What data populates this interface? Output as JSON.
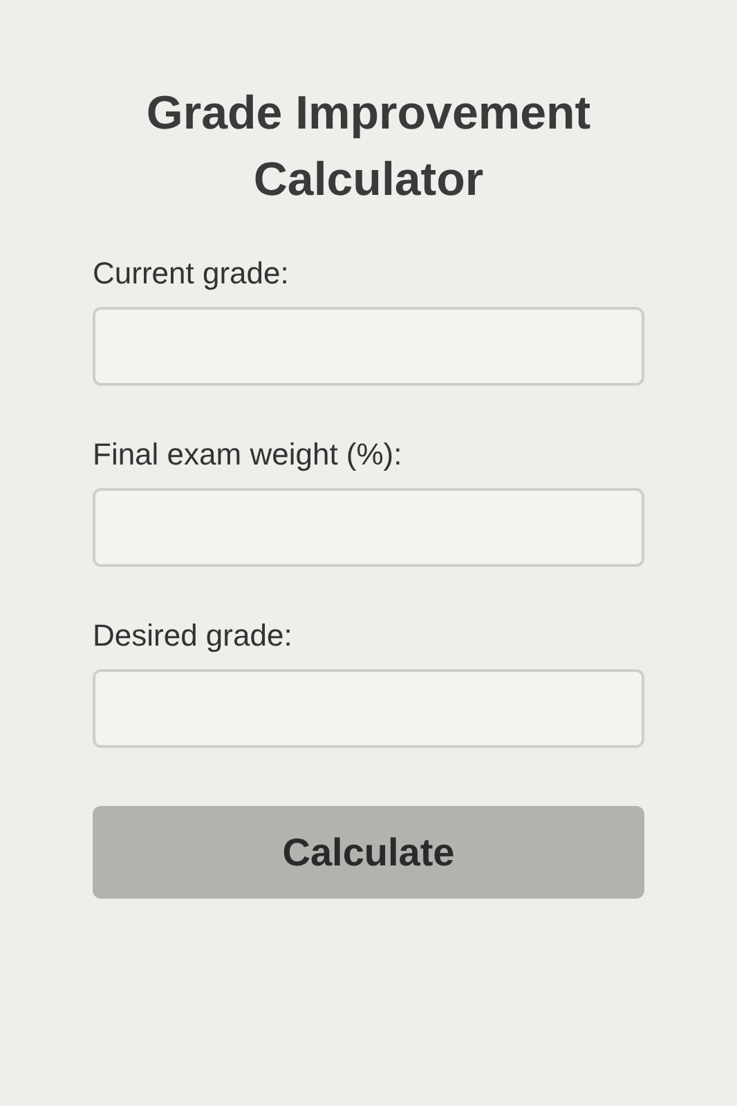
{
  "title": "Grade Improvement Calculator",
  "fields": [
    {
      "label": "Current grade:"
    },
    {
      "label": "Final exam weight (%):"
    },
    {
      "label": "Desired grade:"
    }
  ],
  "button": {
    "label": "Calculate"
  }
}
